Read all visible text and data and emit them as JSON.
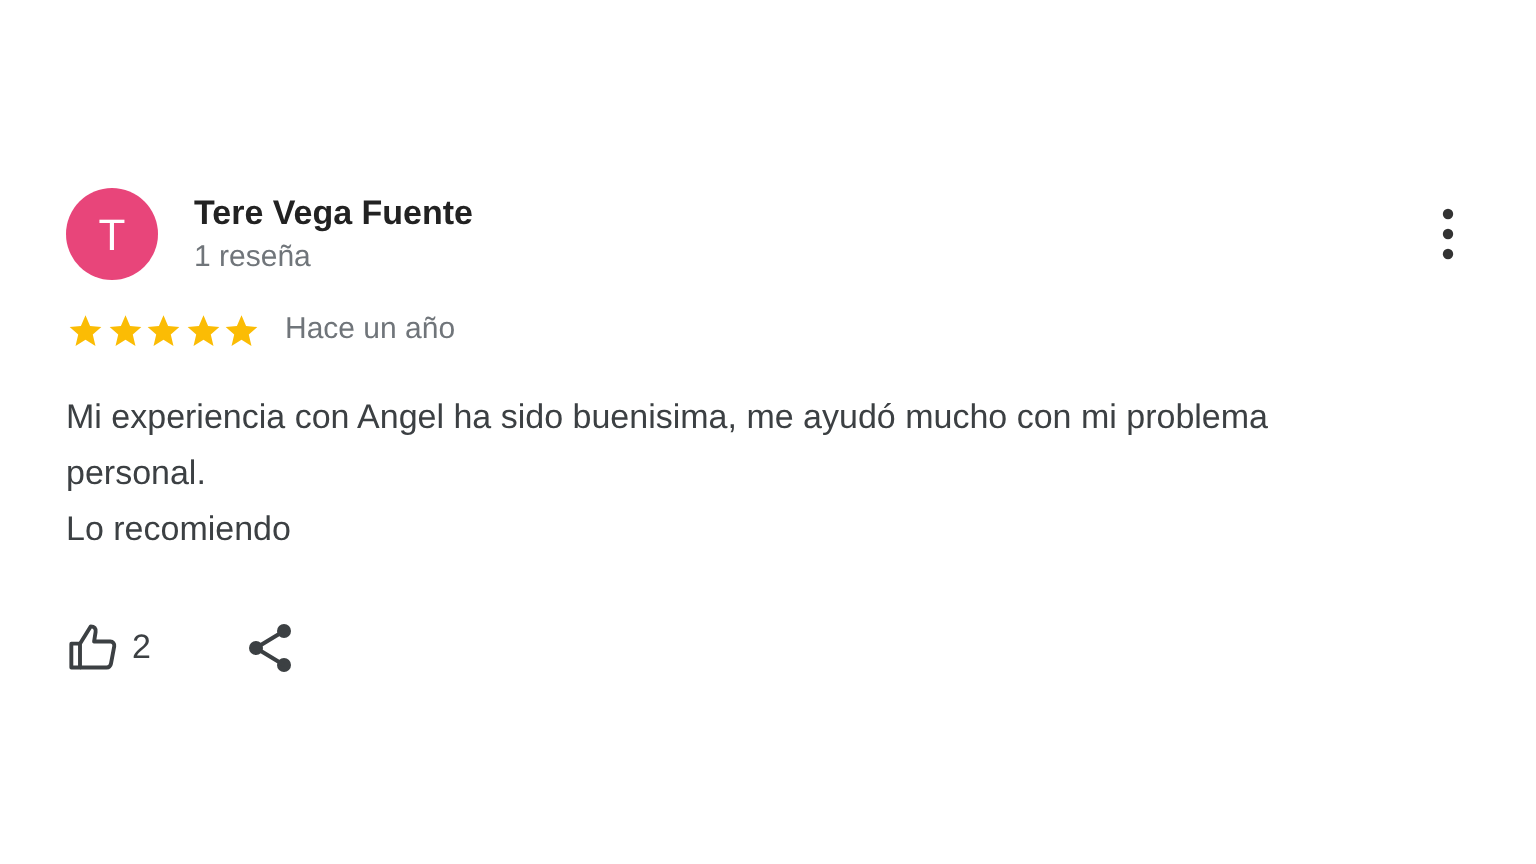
{
  "review": {
    "avatar_letter": "T",
    "author": "Tere Vega Fuente",
    "author_meta": "1 reseña",
    "stars": 5,
    "time": "Hace un año",
    "text": "Mi experiencia con Angel ha sido buenisima, me ayudó mucho con mi problema personal.\nLo recomiendo",
    "likes": "2"
  }
}
